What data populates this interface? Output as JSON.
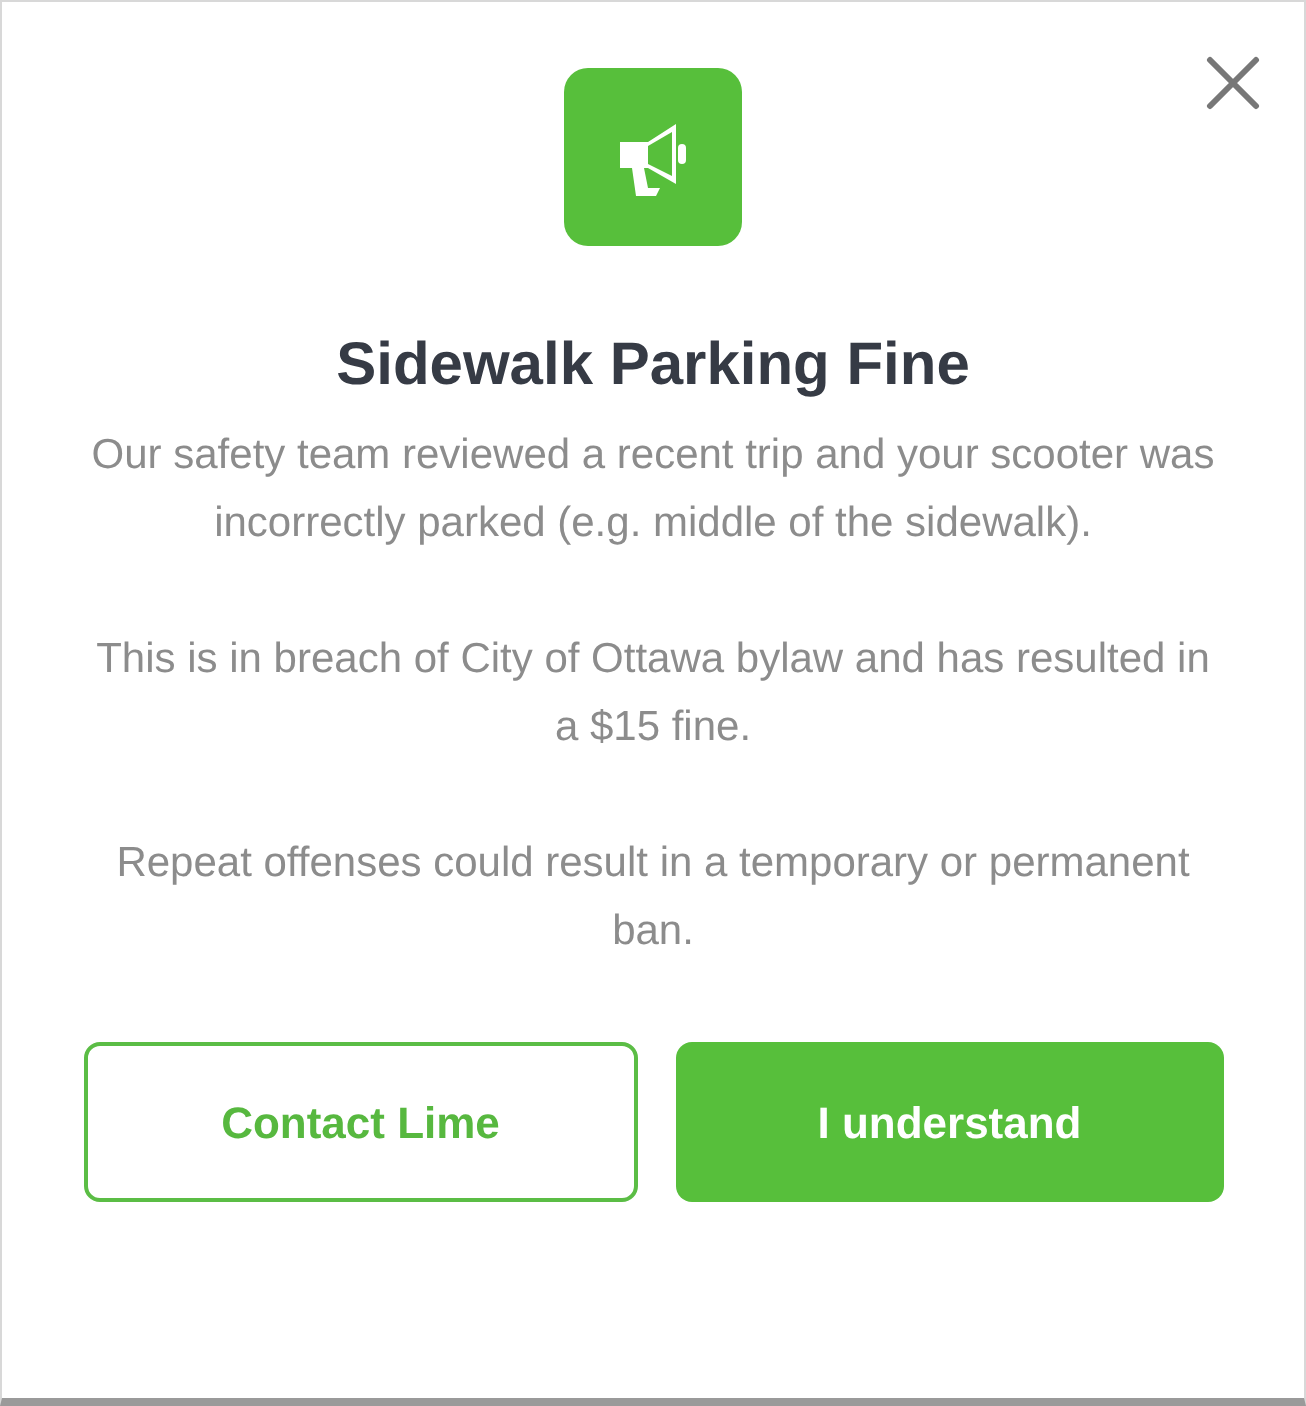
{
  "dialog": {
    "title": "Sidewalk Parking Fine",
    "paragraphs": [
      "Our safety team reviewed a recent trip and your scooter was incorrectly parked (e.g. middle of the sidewalk).",
      "This is in breach of City of Ottawa bylaw and has resulted in a $15 fine.",
      "Repeat offenses could result in a temporary or permanent ban."
    ],
    "buttons": [
      {
        "label": "Contact Lime",
        "kind": "secondary"
      },
      {
        "label": "I understand",
        "kind": "primary"
      }
    ]
  }
}
